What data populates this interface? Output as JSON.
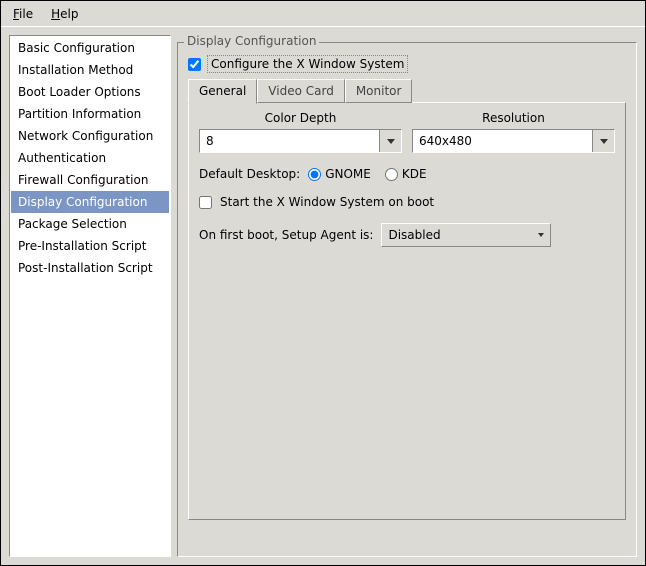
{
  "menu": {
    "file": "File",
    "file_accel": "F",
    "help": "Help",
    "help_accel": "H"
  },
  "sidebar": {
    "items": [
      "Basic Configuration",
      "Installation Method",
      "Boot Loader Options",
      "Partition Information",
      "Network Configuration",
      "Authentication",
      "Firewall Configuration",
      "Display Configuration",
      "Package Selection",
      "Pre-Installation Script",
      "Post-Installation Script"
    ],
    "selected_index": 7
  },
  "panel": {
    "title": "Display Configuration",
    "configure_x_checked": true,
    "configure_x_label": "Configure the X Window System",
    "tabs": [
      "General",
      "Video Card",
      "Monitor"
    ],
    "active_tab": 0,
    "color_depth_label": "Color Depth",
    "color_depth_value": "8",
    "resolution_label": "Resolution",
    "resolution_value": "640x480",
    "default_desktop_label": "Default Desktop:",
    "desktop_options": [
      "GNOME",
      "KDE"
    ],
    "desktop_selected": "GNOME",
    "start_x_boot_checked": false,
    "start_x_boot_label": "Start the X Window System on boot",
    "first_boot_label": "On first boot, Setup Agent is:",
    "first_boot_value": "Disabled"
  }
}
